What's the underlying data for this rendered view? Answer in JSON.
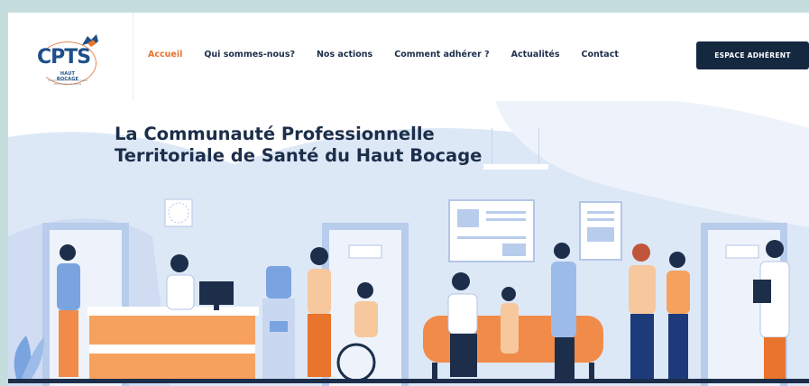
{
  "brand": {
    "logo_main": "CPTS",
    "logo_sub": "HAUT BOCAGE",
    "logo_tagline": "Communauté Professionnelle Territoriale de Santé"
  },
  "nav": {
    "items": [
      {
        "label": "Accueil",
        "active": true
      },
      {
        "label": "Qui sommes-nous?",
        "active": false
      },
      {
        "label": "Nos actions",
        "active": false
      },
      {
        "label": "Comment adhérer ?",
        "active": false
      },
      {
        "label": "Actualités",
        "active": false
      },
      {
        "label": "Contact",
        "active": false
      }
    ],
    "cta_label": "ESPACE ADHÉRENT"
  },
  "hero": {
    "title_line1": "La Communauté Professionnelle",
    "title_line2": "Territoriale de Santé du Haut Bocage",
    "illustration": "clinic-waiting-room-illustration"
  },
  "colors": {
    "accent": "#e8742d",
    "navy": "#14283f",
    "text": "#1c2e4a",
    "hero_bg": "#dde8f7",
    "page_bg": "#c5dedd"
  }
}
